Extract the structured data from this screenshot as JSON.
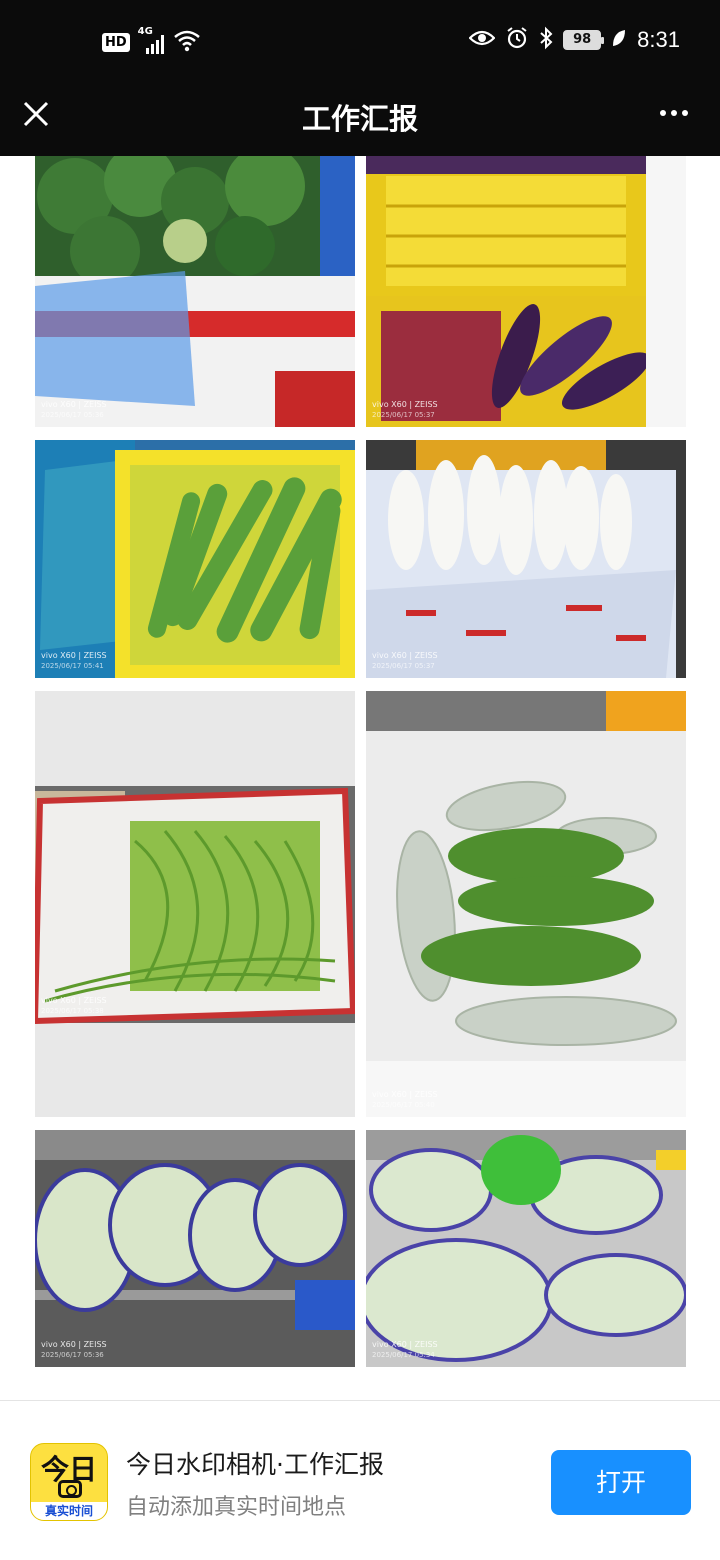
{
  "status_bar": {
    "hd_label": "HD",
    "network_label": "4G",
    "battery_level": "98",
    "time": "8:31",
    "icons": [
      "hd-icon",
      "signal-icon",
      "wifi-icon",
      "eye-icon",
      "alarm-icon",
      "bluetooth-icon",
      "battery-icon",
      "leaf-icon"
    ]
  },
  "nav": {
    "title": "工作汇报",
    "close_icon": "close-icon",
    "more_icon": "more-icon"
  },
  "photos": [
    {
      "subject": "broccoli",
      "watermark_brand": "vivo X60 | ZEISS",
      "watermark_date": "2025/06/17 05:36"
    },
    {
      "subject": "eggplant",
      "watermark_brand": "vivo X60 | ZEISS",
      "watermark_date": "2025/06/17 05:37"
    },
    {
      "subject": "cucumber",
      "watermark_brand": "vivo X60 | ZEISS",
      "watermark_date": "2025/06/17 05:41"
    },
    {
      "subject": "radish",
      "watermark_brand": "vivo X60 | ZEISS",
      "watermark_date": "2025/06/17 05:37"
    },
    {
      "subject": "long-beans",
      "watermark_brand": "vivo X60 | ZEISS",
      "watermark_date": "2025/06/17 05:38"
    },
    {
      "subject": "zucchini",
      "watermark_brand": "vivo X60 | ZEISS",
      "watermark_date": "2025/06/17 05:40"
    },
    {
      "subject": "bagged-greens",
      "watermark_brand": "vivo X60 | ZEISS",
      "watermark_date": "2025/06/17 05:36"
    },
    {
      "subject": "bagged-cabbage",
      "watermark_brand": "vivo X60 | ZEISS",
      "watermark_date": "2025/06/17 05:34"
    }
  ],
  "app_banner": {
    "icon_main_text": "今日",
    "icon_tag_text": "真实时间",
    "name": "今日水印相机·工作汇报",
    "description": "自动添加真实时间地点",
    "open_button": "打开"
  },
  "colors": {
    "bar_background": "#0b0b0b",
    "open_button": "#1890ff",
    "app_icon": "#fde040"
  }
}
